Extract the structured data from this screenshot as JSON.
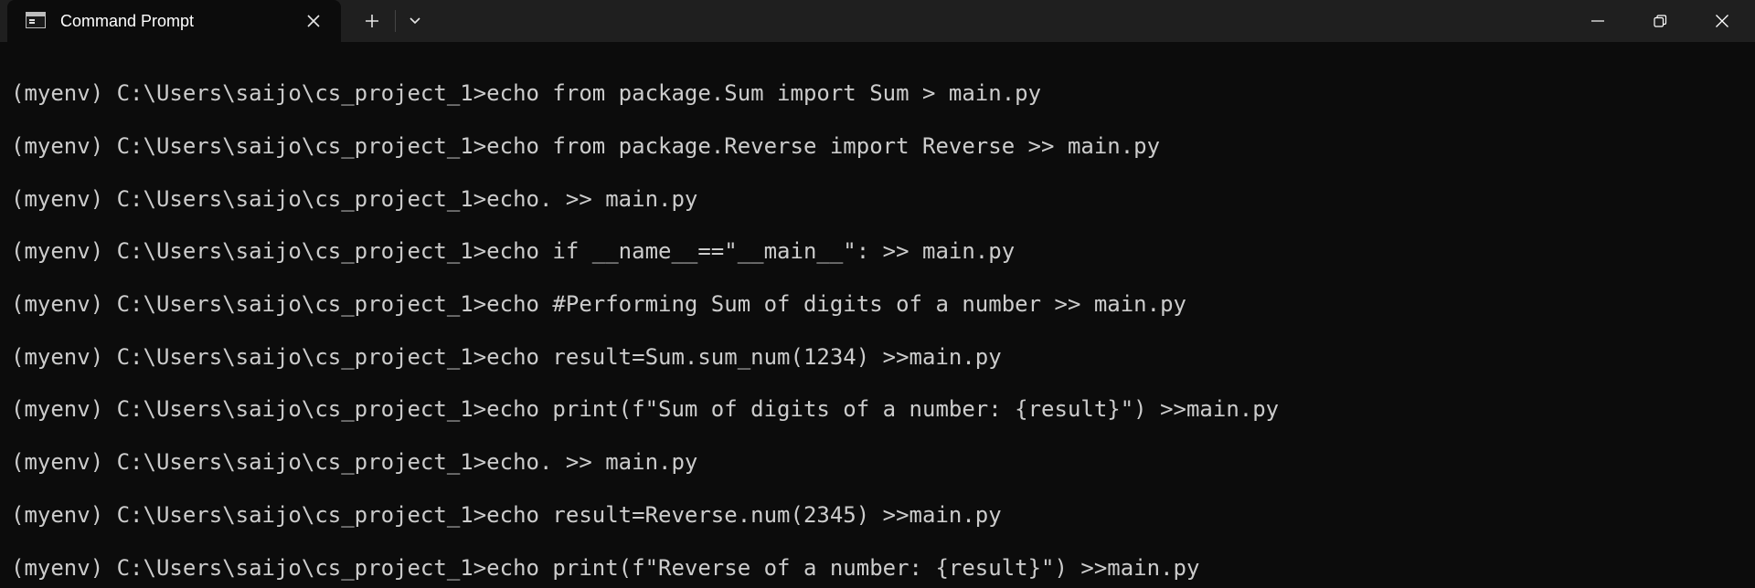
{
  "window": {
    "tab_title": "Command Prompt"
  },
  "icons": {
    "tab_icon": "cmd-icon",
    "tab_close": "close-icon",
    "new_tab": "plus-icon",
    "dropdown": "chevron-down-icon",
    "minimize": "minimize-icon",
    "maximize": "restore-icon",
    "close": "close-icon"
  },
  "colors": {
    "background": "#0c0c0c",
    "titlebar": "#1f1f1f",
    "text": "#cccccc"
  },
  "terminal": {
    "lines": [
      "(myenv) C:\\Users\\saijo\\cs_project_1>echo from package.Sum import Sum > main.py",
      "(myenv) C:\\Users\\saijo\\cs_project_1>echo from package.Reverse import Reverse >> main.py",
      "(myenv) C:\\Users\\saijo\\cs_project_1>echo. >> main.py",
      "(myenv) C:\\Users\\saijo\\cs_project_1>echo if __name__==\"__main__\": >> main.py",
      "(myenv) C:\\Users\\saijo\\cs_project_1>echo #Performing Sum of digits of a number >> main.py",
      "(myenv) C:\\Users\\saijo\\cs_project_1>echo result=Sum.sum_num(1234) >>main.py",
      "(myenv) C:\\Users\\saijo\\cs_project_1>echo print(f\"Sum of digits of a number: {result}\") >>main.py",
      "(myenv) C:\\Users\\saijo\\cs_project_1>echo. >> main.py",
      "(myenv) C:\\Users\\saijo\\cs_project_1>echo result=Reverse.num(2345) >>main.py",
      "(myenv) C:\\Users\\saijo\\cs_project_1>echo print(f\"Reverse of a number: {result}\") >>main.py"
    ]
  }
}
